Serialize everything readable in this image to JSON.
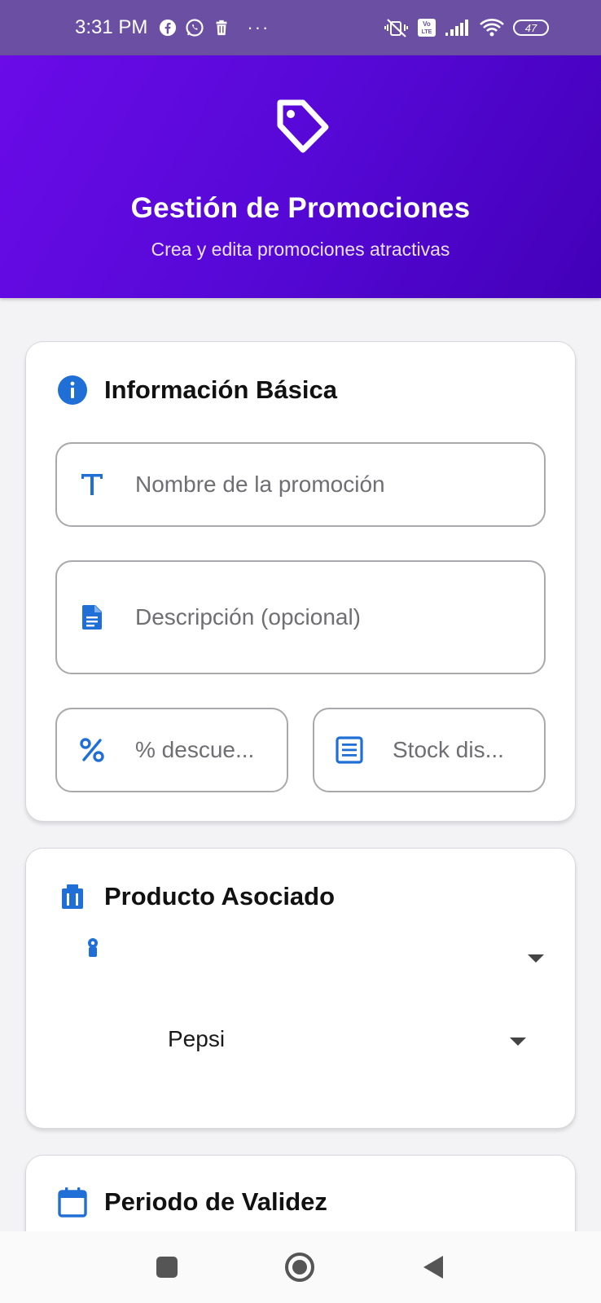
{
  "status_bar": {
    "time": "3:31 PM",
    "more": "···",
    "volte": "Vo LTE",
    "battery": "47"
  },
  "header": {
    "title": "Gestión de Promociones",
    "subtitle": "Crea y edita promociones atractivas",
    "icon": "tag-icon"
  },
  "basic_info": {
    "title": "Información Básica",
    "icon": "info-icon",
    "fields": {
      "name": {
        "placeholder": "Nombre de la promoción",
        "value": "",
        "icon": "text-icon"
      },
      "description": {
        "placeholder": "Descripción (opcional)",
        "value": "",
        "icon": "document-icon"
      },
      "discount": {
        "placeholder": "% descue...",
        "value": "",
        "icon": "percent-icon"
      },
      "stock": {
        "placeholder": "Stock dis...",
        "value": "",
        "icon": "list-icon"
      }
    }
  },
  "product": {
    "title": "Producto Asociado",
    "icon": "inventory-icon",
    "category_selected": "",
    "product_selected": "Pepsi"
  },
  "validity": {
    "title": "Periodo de Validez",
    "icon": "calendar-icon"
  },
  "colors": {
    "status_bar": "#6a4fa3",
    "header_start": "#6a0be8",
    "header_end": "#4200b8",
    "icon_blue": "#1f6fd6"
  }
}
